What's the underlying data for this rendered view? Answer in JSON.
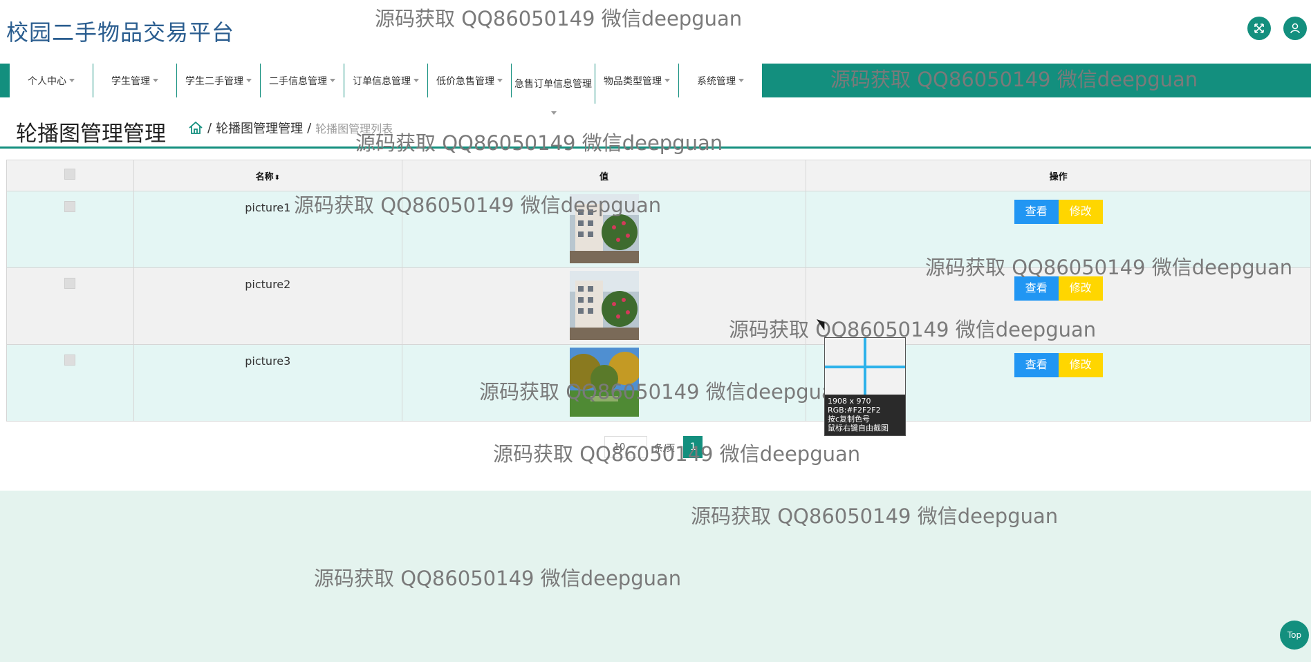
{
  "header": {
    "site_title": "校园二手物品交易平台",
    "expand_icon": "expand-icon",
    "user_icon": "user-icon"
  },
  "nav": {
    "items": [
      {
        "label": "个人中心",
        "caret": true
      },
      {
        "label": "学生管理",
        "caret": true
      },
      {
        "label": "学生二手管理",
        "caret": true
      },
      {
        "label": "二手信息管理",
        "caret": true
      },
      {
        "label": "订单信息管理",
        "caret": true
      },
      {
        "label": "低价急售管理",
        "caret": true
      },
      {
        "label": "急售订单信息管理",
        "caret": false
      },
      {
        "label": "物品类型管理",
        "caret": true
      },
      {
        "label": "系统管理",
        "caret": true
      }
    ]
  },
  "page": {
    "title": "轮播图管理管理",
    "breadcrumb": {
      "home_icon": "home-icon",
      "level1": "轮播图管理管理",
      "separator": "/",
      "current": "轮播图管理列表"
    }
  },
  "table": {
    "headers": {
      "name": "名称",
      "value": "值",
      "actions": "操作"
    },
    "rows": [
      {
        "name": "picture1",
        "image": "campus-building-photo",
        "view": "查看",
        "edit": "修改"
      },
      {
        "name": "picture2",
        "image": "campus-building-photo",
        "view": "查看",
        "edit": "修改"
      },
      {
        "name": "picture3",
        "image": "campus-garden-photo",
        "view": "查看",
        "edit": "修改"
      }
    ]
  },
  "pager": {
    "page_size": "10",
    "per_label": "条/页",
    "current_page": "1"
  },
  "footer": {
    "top_button": "Top"
  },
  "watermark_text": "源码获取 QQ86050149 微信deepguan",
  "color_picker": {
    "size": "1908 x 970",
    "rgb": "RGB:#F2F2F2",
    "hint1": "按c复制色号",
    "hint2": "鼠标右键自由截图"
  },
  "colors": {
    "primary": "#138f7e",
    "view_button": "#2196f3",
    "edit_button": "#ffd600",
    "title_blue": "#2a5d8f"
  }
}
